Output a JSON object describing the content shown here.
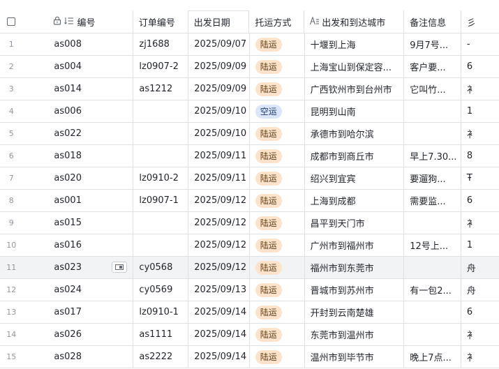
{
  "header": {
    "code": "编号",
    "order": "订单编号",
    "date": "出发日期",
    "ship": "托运方式",
    "city": "出发和到达城市",
    "note": "备注信息",
    "extra": "彡"
  },
  "icons": {
    "lock": "lock-icon",
    "list": "list-icon",
    "text": "text-icon",
    "expand": "expand-record-icon"
  },
  "colors": {
    "land_tag": "#fde3c9",
    "air_tag": "#d9e6fb",
    "border": "#dee0e3",
    "hover_row": "#f2f3f5"
  },
  "rows": [
    {
      "idx": "1",
      "code": "as008",
      "order": "zj1688",
      "date": "2025/09/07",
      "ship": "陆运",
      "ship_type": "land",
      "city": "十堰到上海",
      "note": "9月7号...",
      "extra": "-"
    },
    {
      "idx": "2",
      "code": "as004",
      "order": "lz0907-2",
      "date": "2025/09/09",
      "ship": "陆运",
      "ship_type": "land",
      "city": "上海宝山到保定容...",
      "note": "客户要...",
      "extra": "6"
    },
    {
      "idx": "3",
      "code": "as014",
      "order": "as1212",
      "date": "2025/09/09",
      "ship": "陆运",
      "ship_type": "land",
      "city": "广西钦州市到台州市",
      "note": "它叫竹...",
      "extra": "衤"
    },
    {
      "idx": "4",
      "code": "as006",
      "order": "",
      "date": "2025/09/10",
      "ship": "空运",
      "ship_type": "air",
      "city": "昆明到山南",
      "note": "",
      "extra": "1"
    },
    {
      "idx": "5",
      "code": "as022",
      "order": "",
      "date": "2025/09/10",
      "ship": "陆运",
      "ship_type": "land",
      "city": "承德市到哈尔滨",
      "note": "",
      "extra": "衤"
    },
    {
      "idx": "6",
      "code": "as018",
      "order": "",
      "date": "2025/09/11",
      "ship": "陆运",
      "ship_type": "land",
      "city": "成都市到商丘市",
      "note": "早上7.30...",
      "extra": "8"
    },
    {
      "idx": "7",
      "code": "as020",
      "order": "lz0910-2",
      "date": "2025/09/11",
      "ship": "陆运",
      "ship_type": "land",
      "city": "绍兴到宜宾",
      "note": "要遛狗...",
      "extra": "Ŧ"
    },
    {
      "idx": "8",
      "code": "as001",
      "order": "lz0907-1",
      "date": "2025/09/12",
      "ship": "陆运",
      "ship_type": "land",
      "city": "上海到成都",
      "note": "需要监...",
      "extra": "6"
    },
    {
      "idx": "9",
      "code": "as015",
      "order": "",
      "date": "2025/09/12",
      "ship": "陆运",
      "ship_type": "land",
      "city": "昌平到天门市",
      "note": "",
      "extra": "衤"
    },
    {
      "idx": "10",
      "code": "as016",
      "order": "",
      "date": "2025/09/12",
      "ship": "陆运",
      "ship_type": "land",
      "city": "广州市到福州市",
      "note": "12号上...",
      "extra": "1"
    },
    {
      "idx": "11",
      "code": "as023",
      "order": "cy0568",
      "date": "2025/09/12",
      "ship": "陆运",
      "ship_type": "land",
      "city": "福州市到东莞市",
      "note": "",
      "extra": "舟"
    },
    {
      "idx": "12",
      "code": "as024",
      "order": "cy0569",
      "date": "2025/09/13",
      "ship": "陆运",
      "ship_type": "land",
      "city": "晋城市到苏州市",
      "note": "有一包2...",
      "extra": "舟"
    },
    {
      "idx": "13",
      "code": "as017",
      "order": "lz0910-1",
      "date": "2025/09/14",
      "ship": "陆运",
      "ship_type": "land",
      "city": "开封到云南楚雄",
      "note": "",
      "extra": "6"
    },
    {
      "idx": "14",
      "code": "as026",
      "order": "as1111",
      "date": "2025/09/14",
      "ship": "陆运",
      "ship_type": "land",
      "city": "东莞市到温州市",
      "note": "",
      "extra": "衤"
    },
    {
      "idx": "15",
      "code": "as028",
      "order": "as2222",
      "date": "2025/09/14",
      "ship": "陆运",
      "ship_type": "land",
      "city": "温州市到毕节市",
      "note": "晚上7点...",
      "extra": "衤"
    }
  ]
}
